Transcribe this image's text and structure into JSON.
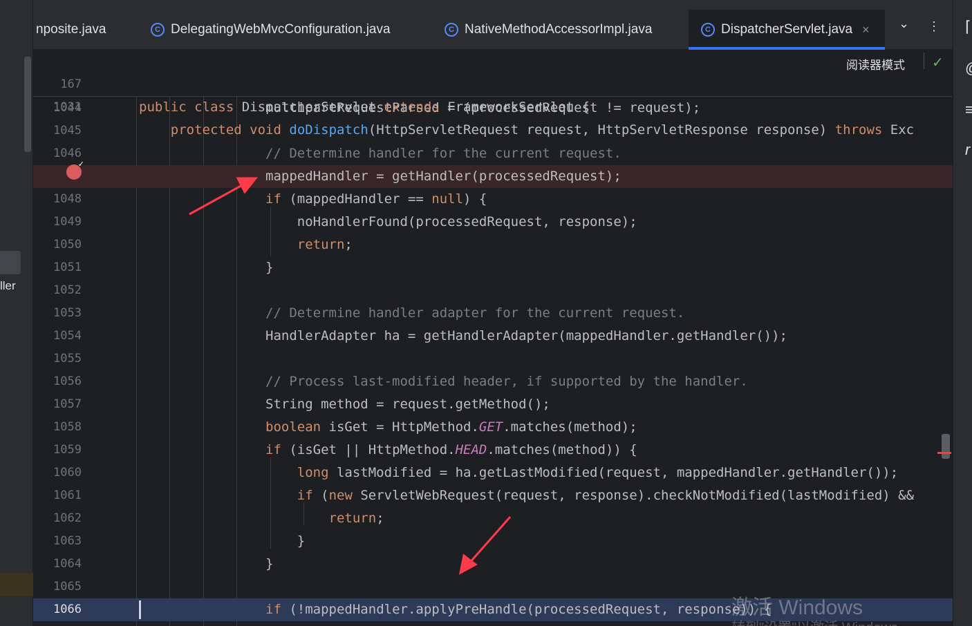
{
  "tabs": [
    {
      "label": "nposite.java",
      "icon": "none"
    },
    {
      "label": "DelegatingWebMvcConfiguration.java",
      "icon": "class-icon"
    },
    {
      "label": "NativeMethodAccessorImpl.java",
      "icon": "class-icon"
    },
    {
      "label": "DispatcherServlet.java",
      "icon": "class-icon",
      "active": true
    }
  ],
  "tab_close_glyph": "×",
  "tab_more_glyph": "⌄",
  "tab_menu_glyph": "⋮",
  "left_panel_text": "ller",
  "reader_mode": "阅读器模式",
  "check_glyph": "✓",
  "right_icons": [
    "⌈",
    "@",
    "≡",
    "r"
  ],
  "sticky": [
    {
      "ln": "167",
      "code": "public class DispatcherServlet extends FrameworkServlet {"
    },
    {
      "ln": "1031",
      "code": "    protected void doDispatch(HttpServletRequest request, HttpServletResponse response) throws Exc"
    }
  ],
  "lines": [
    {
      "ln": "1044",
      "code": "                multipartRequestParsed = (processedRequest != request);"
    },
    {
      "ln": "1045",
      "code": ""
    },
    {
      "ln": "1046",
      "code": "                // Determine handler for the current request."
    },
    {
      "ln": "",
      "code": "                mappedHandler = getHandler(processedRequest);"
    },
    {
      "ln": "1048",
      "code": "                if (mappedHandler == null) {"
    },
    {
      "ln": "1049",
      "code": "                    noHandlerFound(processedRequest, response);"
    },
    {
      "ln": "1050",
      "code": "                    return;"
    },
    {
      "ln": "1051",
      "code": "                }"
    },
    {
      "ln": "1052",
      "code": ""
    },
    {
      "ln": "1053",
      "code": "                // Determine handler adapter for the current request."
    },
    {
      "ln": "1054",
      "code": "                HandlerAdapter ha = getHandlerAdapter(mappedHandler.getHandler());"
    },
    {
      "ln": "1055",
      "code": ""
    },
    {
      "ln": "1056",
      "code": "                // Process last-modified header, if supported by the handler."
    },
    {
      "ln": "1057",
      "code": "                String method = request.getMethod();"
    },
    {
      "ln": "1058",
      "code": "                boolean isGet = HttpMethod.GET.matches(method);"
    },
    {
      "ln": "1059",
      "code": "                if (isGet || HttpMethod.HEAD.matches(method)) {"
    },
    {
      "ln": "1060",
      "code": "                    long lastModified = ha.getLastModified(request, mappedHandler.getHandler());"
    },
    {
      "ln": "1061",
      "code": "                    if (new ServletWebRequest(request, response).checkNotModified(lastModified) &&"
    },
    {
      "ln": "1062",
      "code": "                        return;"
    },
    {
      "ln": "1063",
      "code": "                    }"
    },
    {
      "ln": "1064",
      "code": "                }"
    },
    {
      "ln": "1065",
      "code": ""
    },
    {
      "ln": "1066",
      "code": "                if (!mappedHandler.applyPreHandle(processedRequest, response)) {"
    }
  ],
  "watermark": "激活 Windows",
  "watermark2": "转到\"设置\"以激活 Windows",
  "colors": {
    "breakpoint": "#db5c5c",
    "annotation_arrow": "#ff3b4a",
    "keyword": "#cf8e6d",
    "method": "#56a8f5",
    "comment": "#7a7e85",
    "static_field": "#c77dbb"
  }
}
